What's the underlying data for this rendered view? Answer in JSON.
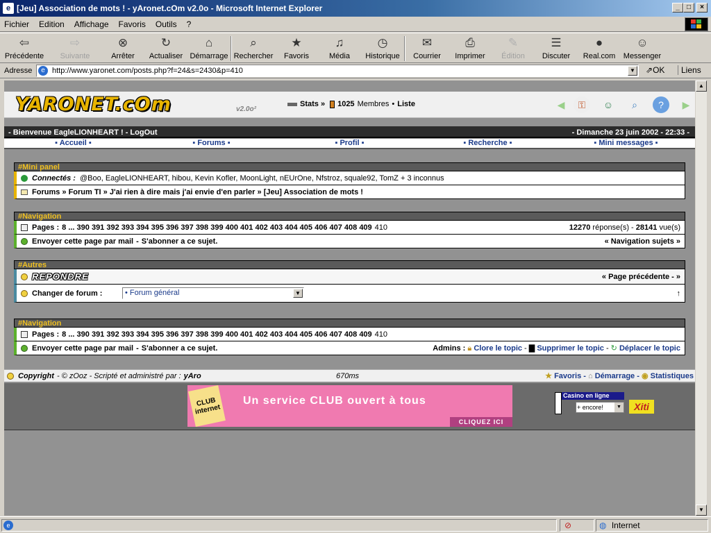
{
  "window": {
    "title": "[Jeu] Association de mots ! - yAronet.cOm v2.0o - Microsoft Internet Explorer",
    "buttons": {
      "minimize": "_",
      "maximize": "□",
      "close": "×"
    }
  },
  "menu": [
    "Fichier",
    "Edition",
    "Affichage",
    "Favoris",
    "Outils",
    "?"
  ],
  "toolbar": [
    {
      "label": "Précédente",
      "icon": "back-arrow-icon",
      "glyph": "⇦",
      "enabled": true
    },
    {
      "label": "Suivante",
      "icon": "forward-arrow-icon",
      "glyph": "⇨",
      "enabled": false
    },
    {
      "label": "Arrêter",
      "icon": "stop-icon",
      "glyph": "⊗",
      "enabled": true
    },
    {
      "label": "Actualiser",
      "icon": "refresh-icon",
      "glyph": "↻",
      "enabled": true
    },
    {
      "label": "Démarrage",
      "icon": "home-icon",
      "glyph": "⌂",
      "enabled": true
    },
    {
      "label": "Rechercher",
      "icon": "search-icon",
      "glyph": "⌕",
      "enabled": true
    },
    {
      "label": "Favoris",
      "icon": "favorites-icon",
      "glyph": "★",
      "enabled": true
    },
    {
      "label": "Média",
      "icon": "media-icon",
      "glyph": "♫",
      "enabled": true
    },
    {
      "label": "Historique",
      "icon": "history-icon",
      "glyph": "◷",
      "enabled": true
    },
    {
      "label": "Courrier",
      "icon": "mail-icon",
      "glyph": "✉",
      "enabled": true
    },
    {
      "label": "Imprimer",
      "icon": "print-icon",
      "glyph": "⎙",
      "enabled": true
    },
    {
      "label": "Édition",
      "icon": "edit-icon",
      "glyph": "✎",
      "enabled": false
    },
    {
      "label": "Discuter",
      "icon": "discuss-icon",
      "glyph": "☰",
      "enabled": true
    },
    {
      "label": "Real.com",
      "icon": "real-icon",
      "glyph": "●",
      "enabled": true
    },
    {
      "label": "Messenger",
      "icon": "messenger-icon",
      "glyph": "☺",
      "enabled": true
    }
  ],
  "address": {
    "label": "Adresse",
    "url": "http://www.yaronet.com/posts.php?f=24&s=2430&p=410",
    "go": "OK",
    "links": "Liens"
  },
  "site": {
    "logo": "YARONET.cOm",
    "version": "v2.0o²",
    "stats_label": "Stats »",
    "members_count": "1025",
    "members_label": "Membres",
    "list_label": "Liste"
  },
  "welcome": {
    "left": "- Bienvenue EagleLIONHEART ! - LogOut",
    "right": "- Dimanche 23 juin 2002 - 22:33 -"
  },
  "topnav": [
    "Accueil",
    "Forums",
    "Profil",
    "Recherche",
    "Mini messages"
  ],
  "mini_panel": {
    "title": "#Mini panel",
    "connected_label": "Connectés :",
    "connected_list": "@Boo, EagleLIONHEART, hibou, Kevin Kofler, MoonLight, nEUrOne, Nfstroz, squale92, TomZ + 3 inconnus",
    "breadcrumb": "Forums » Forum TI » J'ai rien à dire mais j'ai envie d'en parler » [Jeu] Association de mots !"
  },
  "navigation1": {
    "title": "#Navigation",
    "pages_label": "Pages :",
    "pages_links": "8 ... 390 391 392 393 394 395 396 397 398 399 400 401 402 403 404 405 406 407 408 409",
    "current_page": "410",
    "replies_count": "12270",
    "replies_label": "réponse(s) -",
    "views_count": "28141",
    "views_label": "vue(s)",
    "send_email": "Envoyer cette page par mail",
    "subscribe": "S'abonner a ce sujet.",
    "nav_subjects": "« Navigation sujets »"
  },
  "autres": {
    "title": "#Autres",
    "reply": "REPONDRE",
    "prev_page": "« Page précédente - »",
    "change_forum_label": "Changer de forum :",
    "forum_select": "• Forum général",
    "up_arrow": "↑"
  },
  "navigation2": {
    "title": "#Navigation",
    "pages_label": "Pages :",
    "pages_links": "8 ... 390 391 392 393 394 395 396 397 398 399 400 401 402 403 404 405 406 407 408 409",
    "current_page": "410",
    "send_email": "Envoyer cette page par mail",
    "subscribe": "S'abonner a ce sujet.",
    "admins_label": "Admins :",
    "close_topic": "Clore le topic",
    "delete_topic": "Supprimer le topic",
    "move_topic": "Déplacer le topic"
  },
  "footer": {
    "copyright": "Copyright",
    "credits": "- © zOoz - Scripté et administré par :",
    "admin": "yAro",
    "time": "670ms",
    "favoris": "Favoris -",
    "demarrage": "Démarrage -",
    "statistiques": "Statistiques"
  },
  "ads": {
    "club_logo": "CLUB internet",
    "banner_text": "Un service CLUB ouvert à tous",
    "banner_click": "CLIQUEZ ICI",
    "casino_title": "Casino en ligne",
    "casino_value": "+ encore!",
    "xiti": "Xiti"
  },
  "status": {
    "zone": "Internet"
  },
  "colors": {
    "accent_yellow": "#f0c020",
    "panel_bar_yellow": "#e8b400",
    "panel_bar_green": "#5cb02c",
    "panel_bar_teal": "#4a8aa0",
    "link_blue": "#1a3a8a"
  }
}
